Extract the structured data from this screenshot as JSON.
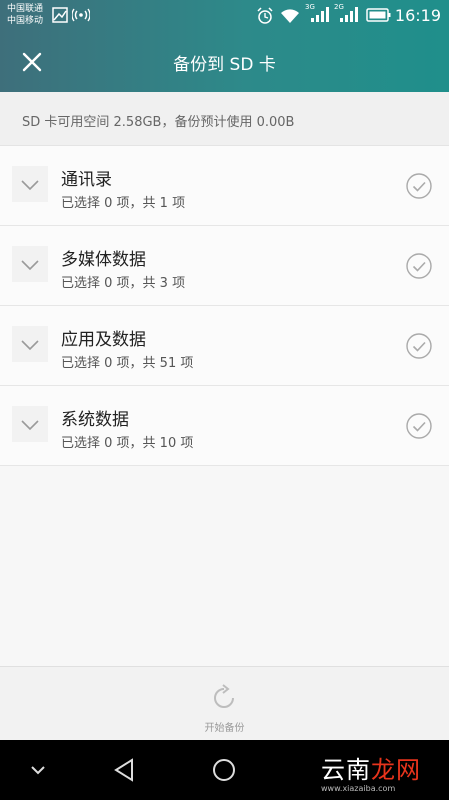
{
  "status_bar": {
    "carrier_1": "中国联通",
    "carrier_2": "中国移动",
    "net_3g": "3G",
    "net_2g": "2G",
    "time": "16:19",
    "icons": [
      "image-icon",
      "hotspot-icon",
      "alarm-icon",
      "wifi-icon",
      "signal-icon",
      "signal-icon",
      "battery-icon"
    ]
  },
  "header": {
    "title": "备份到 SD 卡",
    "close_icon": "close-icon"
  },
  "info": {
    "text": "SD 卡可用空间 2.58GB，备份预计使用 0.00B"
  },
  "items": [
    {
      "title": "通讯录",
      "subtitle": "已选择 0 项，共 1 项"
    },
    {
      "title": "多媒体数据",
      "subtitle": "已选择 0 项，共 3 项"
    },
    {
      "title": "应用及数据",
      "subtitle": "已选择 0 项，共 51 项"
    },
    {
      "title": "系统数据",
      "subtitle": "已选择 0 项，共 10 项"
    }
  ],
  "bottom": {
    "start_label": "开始备份",
    "icon": "refresh-icon"
  },
  "nav": {
    "icons": [
      "chevron-down-icon",
      "back-icon",
      "home-icon"
    ]
  },
  "watermark": {
    "text_white": "云南",
    "text_red": "龙网",
    "url": "www.xiazaiba.com"
  },
  "colors": {
    "header_bg": "#2d8a8a",
    "page_bg": "#f7f7f7",
    "nav_bg": "#000000"
  }
}
